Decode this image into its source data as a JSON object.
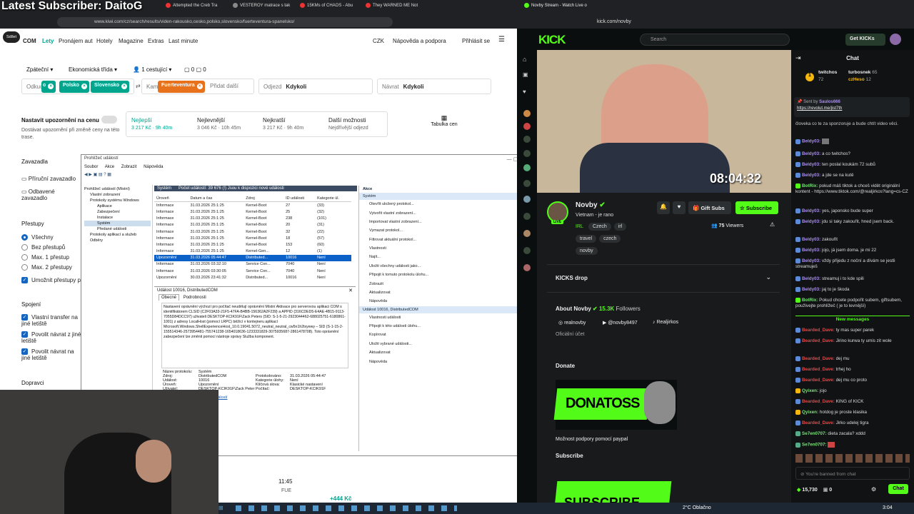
{
  "overlay": {
    "subscriber": "Latest Subscriber: DaitoG"
  },
  "left_browser": {
    "tabs": [
      "Attempted the Creb Tra",
      "VESTEROY matrace s tak",
      "15KMs of CHAOS - Abu",
      "They WARNED ME Not"
    ],
    "url": "www.kiwi.com/cz/search/results/viden-rakousko,cesko,polsko,slovensko/fuerteventura-spanelsko/",
    "share_label": "Sdílet"
  },
  "kiwi": {
    "logo": "COM",
    "nav": [
      "Lety",
      "Pronájem aut",
      "Hotely",
      "Magazine",
      "Extras",
      "Last minute"
    ],
    "currency": "CZK",
    "help": "Nápověda a podpora",
    "login": "Přihlásit se",
    "trip": {
      "type": "Zpáteční",
      "class": "Ekonomická třída",
      "passengers": "1 cestující",
      "bags1": "0",
      "bags2": "0"
    },
    "from_label": "Odkud",
    "chips": [
      "o",
      "Polsko",
      "Slovensko"
    ],
    "to_label": "Kam",
    "to_chip": "Fuerteventura",
    "add_place": "Přidat další",
    "depart_label": "Odjezd",
    "depart_value": "Kdykoli",
    "return_label": "Návrat",
    "return_value": "Kdykoli",
    "notify": {
      "title": "Nastavit upozornění na cenu",
      "desc": "Dostávat upozornění při změně ceny na této trase."
    },
    "sorts": [
      {
        "name": "Nejlepší",
        "detail": "3 217 Kč · 9h 40m"
      },
      {
        "name": "Nejlevnější",
        "detail": "3 046 Kč · 10h 45m"
      },
      {
        "name": "Nejkratší",
        "detail": "3 217 Kč · 9h 40m"
      },
      {
        "name": "Další možnosti",
        "detail": "Nejdřívější odjezd"
      }
    ],
    "price_table": "Tabulka cen",
    "sidebar": {
      "bags": "Zavazadla",
      "cabin": "Příruční zavazadlo",
      "checked": "Odbavené zavazadlo",
      "stops": "Přestupy",
      "all": "Všechny",
      "nonstop": "Bez přestupů",
      "max1": "Max. 1 přestup",
      "max2": "Max. 2 přestupy",
      "allow": "Umožnit přestupy př",
      "transfers": "Spojení",
      "own": "Vlastní transfer na jiné letiště",
      "ret_other": "Povolit návrat z jiné letiště",
      "ret_to": "Povolit návrat na jiné letiště",
      "transport": "Dopravci"
    },
    "result": {
      "time": "11:45",
      "code": "FUE",
      "price": "+444 Kč"
    }
  },
  "event_viewer": {
    "title": "Prohlížeč událostí",
    "menu": [
      "Soubor",
      "Akce",
      "Zobrazit",
      "Nápověda"
    ],
    "tree": [
      "Prohlížeč událostí (Místní)",
      "Vlastní zobrazení",
      "Protokoly systému Windows",
      "Aplikace",
      "Zabezpečení",
      "Instalace",
      "Systém",
      "Předané události",
      "Protokoly aplikací a služeb",
      "Odběry"
    ],
    "log_name": "Systém",
    "log_count": "Počet událostí: 39 676 (!) Jsou k dispozici nové události",
    "columns": [
      "Úroveň",
      "Datum a čas",
      "Zdroj",
      "ID události",
      "Kategorie úl."
    ],
    "rows": [
      [
        "Informace",
        "31.03.2026 25:1:25",
        "Kernel-Boot",
        "27",
        "(33)"
      ],
      [
        "Informace",
        "31.03.2026 25:1:25",
        "Kernel-Boot",
        "25",
        "(32)"
      ],
      [
        "Informace",
        "31.03.2026 25:1:25",
        "Kernel-Boot",
        "238",
        "(101)"
      ],
      [
        "Informace",
        "31.03.2026 25:1:25",
        "Kernel-Boot",
        "20",
        "(31)"
      ],
      [
        "Informace",
        "31.03.2026 25:1:25",
        "Kernel-Boot",
        "32",
        "(22)"
      ],
      [
        "Informace",
        "31.03.2026 25:1:25",
        "Kernel-Boot",
        "18",
        "(57)"
      ],
      [
        "Informace",
        "31.03.2026 25:1:25",
        "Kernel-Boot",
        "153",
        "(60)"
      ],
      [
        "Informace",
        "31.03.2026 25:1:25",
        "Kernel-Gen...",
        "12",
        "(1)"
      ],
      [
        "Upozornění",
        "31.03.2026 05:44:47",
        "Distributed...",
        "10016",
        "Není"
      ],
      [
        "Informace",
        "31.03.2026 03:32:10",
        "Service Con...",
        "7040",
        "Není"
      ],
      [
        "Informace",
        "31.03.2026 03:30:05",
        "Service Con...",
        "7040",
        "Není"
      ],
      [
        "Upozornění",
        "30.03.2026 23:41:32",
        "Distributed...",
        "10016",
        "Není"
      ]
    ],
    "detail_title": "Událost 10016, DistributedCOM",
    "detail_tabs": [
      "Obecné",
      "Podrobnosti"
    ],
    "detail_text": "Nastavení oprávnění výchozí pro počítač neudělují oprávnění Místní Aktivace pro serverovou aplikaci COM s identifikátorem CLSID {C2F03A33-21F5-47FA-B4BB-156362A2F239} a APPID {316CDED5-E4AE-4B15-9113-7055D84DCC97} uživateli DESKTOP-KCIK91F\\Zack Peters (SID: S-1-5-21-2923044462-688025751-6180861-1001) z adresy LocalHost (pomocí LRPC) běžící v kontejneru aplikací Microsoft.Windows.ShellExperienceHost_10.0.19041.5072_neutral_neutral_cw5n1h2txyewy – SID (S-1-15-2-155514346-2573954481-755741238-1654018636-1233331829-3075935687-2861478708). Toto oprávnění zabezpečení lze změnit pomocí nástroje správy Služba komponent.",
    "detail_fields": [
      [
        "Název protokolu:",
        "Systém"
      ],
      [
        "Zdroj:",
        "DistributedCOM",
        "Protokolováno:",
        "31.03.2026 05:44:47"
      ],
      [
        "Událost:",
        "10016",
        "Kategorie úlohy:",
        "Není"
      ],
      [
        "Úroveň:",
        "Upozornění",
        "Klíčová slova:",
        "Klasické nastavení"
      ],
      [
        "Uživatel:",
        "DESKTOP-KCIK91F\\Zack Peter",
        "Počítač:",
        "DESKTOP-KCIK91F"
      ]
    ],
    "detail_link": "Nápověda online k protokolu událostí",
    "actions_header": "Akce",
    "actions_sec1": "Systém",
    "actions1": [
      "Otevřít uložený protokol...",
      "Vytvořit vlastní zobrazení...",
      "Importovat vlastní zobrazení...",
      "Vymazat protokol...",
      "Filtrovat aktuální protokol...",
      "Vlastnosti",
      "Najít...",
      "Uložit všechny události jako...",
      "Připojit k tomuto protokolu úlohu...",
      "Zobrazit",
      "Aktualizovat",
      "Nápověda"
    ],
    "actions_sec2": "Událost 10016, DistributedCOM",
    "actions2": [
      "Vlastnosti události",
      "Připojit k této události úlohu...",
      "Kopírovat",
      "Uložit vybrané události...",
      "Aktualizovat",
      "Nápověda"
    ]
  },
  "right_browser": {
    "tab": "Novby Stream - Watch Live o",
    "url": "kick.com/novby"
  },
  "kick": {
    "logo": "KICK",
    "search_placeholder": "Search",
    "get_kicks": "Get KICKs",
    "stream_time": "08:04:32",
    "channel": {
      "name": "Novby",
      "subtitle": "Vietnam - je rano",
      "category": "IRL",
      "tags": [
        "Czech",
        "irl",
        "travel",
        "czech",
        "novby"
      ],
      "live": "LIVE",
      "viewers": "75",
      "viewers_label": "Viewers",
      "gift_subs": "Gift Subs",
      "subscribe": "Subscribe"
    },
    "kicks_drop": "KICKS drop",
    "about": {
      "title": "About Novby",
      "followers": "15.3K",
      "followers_label": "Followers",
      "socials": [
        "realnovby",
        "@novby8497",
        "Realjirkos"
      ],
      "official": "Oficiální účet"
    },
    "donate": {
      "title": "Donate",
      "banner": "DONATOSS",
      "desc": "Možnost podpory pomocí paypal"
    },
    "subscribe_section": {
      "title": "Subscribe",
      "banner": "SUBSCRIBE"
    },
    "chat": {
      "title": "Chat",
      "leaders": [
        {
          "name": "twitchos",
          "count": "72"
        },
        {
          "name": "turbosnek",
          "count": "65"
        },
        {
          "name": "czHeso",
          "count": "12"
        }
      ],
      "pinned_by": "Sent by",
      "pinned_user": "Saulos666",
      "pinned_link": "https://revolut.me/jist7th",
      "messages": [
        {
          "user": "",
          "text": "človeka co te za sponzoruje a bude chtít video věci."
        },
        {
          "user": "Beldy03:",
          "text": ""
        },
        {
          "user": "Beldy03:",
          "text": "a co twitchos?"
        },
        {
          "user": "Beldy03:",
          "text": "ten poslal koukám 72 subů"
        },
        {
          "user": "Beldy03:",
          "text": "a jde se na kutě"
        },
        {
          "user": "BotRix:",
          "text": "pokud máš tiktok a chceš vidět originální kontent - https://www.tiktok.com/@realjirkos?lang=cs-CZ"
        },
        {
          "user": "Beldy03:",
          "text": "yes, japonsko bude super"
        },
        {
          "user": "Beldy03:",
          "text": "jdu si taky zakouřit, hned jsem back."
        },
        {
          "user": "Beldy03:",
          "text": "zakouřit"
        },
        {
          "user": "Beldy03:",
          "text": "jojo, já jsem doma. je mi 22"
        },
        {
          "user": "Beldy03:",
          "text": "vždy přijedu z noční a dívám se jestli streamuješ"
        },
        {
          "user": "Beldy03:",
          "text": "streamuj i to kde spili"
        },
        {
          "user": "Beldy03:",
          "text": "jaj to je škoda"
        },
        {
          "user": "BotRix:",
          "text": "Pokud chcete podpořit subem, giftsubem, použivejte prohlížeč ( je to levnější)"
        }
      ],
      "new_messages": "New messages",
      "new": [
        {
          "user": "Bearded_Dave:",
          "text": "ty mas super parek"
        },
        {
          "user": "Bearded_Dave:",
          "text": "Jirino kurwa ty umis zit wole"
        },
        {
          "user": "Bearded_Dave:",
          "text": "dej mu"
        },
        {
          "user": "Bearded_Dave:",
          "text": "trhej ho"
        },
        {
          "user": "Bearded_Dave:",
          "text": "dej mu co proto"
        },
        {
          "user": "Qyixen:",
          "text": "jojo"
        },
        {
          "user": "Bearded_Dave:",
          "text": "KING of KICK"
        },
        {
          "user": "Qyixen:",
          "text": "hotdog je proste klasika"
        },
        {
          "user": "Bearded_Dave:",
          "text": "Jirko udelej tigra"
        },
        {
          "user": "Se7en0707:",
          "text": "dieta zacala? xddd"
        },
        {
          "user": "Se7en0707:",
          "text": ""
        }
      ],
      "banned": "You're banned from chat",
      "points": "15,730",
      "points2": "0",
      "chat_button": "Chat"
    }
  },
  "taskbar": {
    "weather": "2°C  Oblačno",
    "time": "3:04"
  }
}
